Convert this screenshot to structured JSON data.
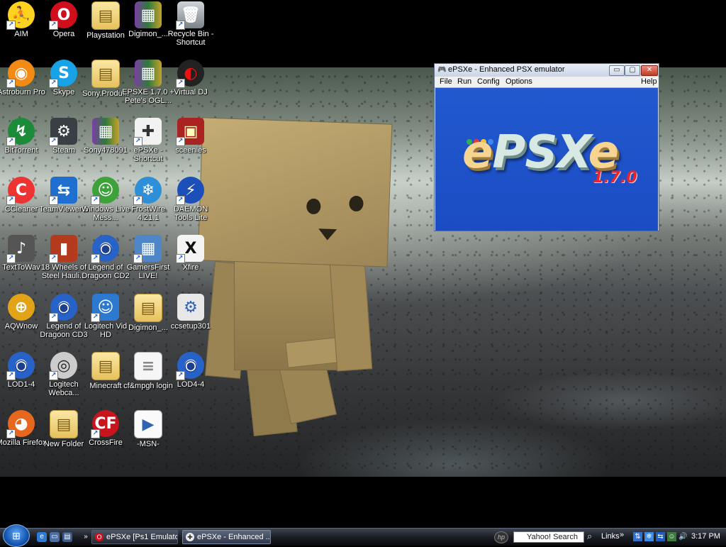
{
  "desktop": {
    "icons": [
      {
        "label": "AIM",
        "glyph": "⛹",
        "icon": "aim-icon",
        "shortcut": true
      },
      {
        "label": "Opera",
        "glyph": "O",
        "icon": "opera-icon",
        "shortcut": true
      },
      {
        "label": "Playstation",
        "glyph": "▤",
        "icon": "folder-icon",
        "shortcut": false
      },
      {
        "label": "Digimon_...",
        "glyph": "▦",
        "icon": "winrar-archive-icon",
        "shortcut": false
      },
      {
        "label": "Recycle Bin - Shortcut",
        "glyph": "🗑",
        "icon": "recycle-bin-icon",
        "shortcut": true
      },
      {
        "label": "Astroburn Pro",
        "glyph": "◉",
        "icon": "astroburn-icon",
        "shortcut": true
      },
      {
        "label": "Skype",
        "glyph": "S",
        "icon": "skype-icon",
        "shortcut": true
      },
      {
        "label": "Sony.Produ...",
        "glyph": "▤",
        "icon": "folder-icon",
        "shortcut": false
      },
      {
        "label": "EPSXE 1.7.0 + Pete's OGL...",
        "glyph": "▦",
        "icon": "winrar-archive-icon",
        "shortcut": false
      },
      {
        "label": "Virtual DJ",
        "glyph": "◐",
        "icon": "virtual-dj-icon",
        "shortcut": true
      },
      {
        "label": "BitTorrent",
        "glyph": "↯",
        "icon": "bittorrent-icon",
        "shortcut": true
      },
      {
        "label": "Steam",
        "glyph": "⚙",
        "icon": "steam-icon",
        "shortcut": true
      },
      {
        "label": "Sony478091",
        "glyph": "▦",
        "icon": "winrar-archive-icon",
        "shortcut": false
      },
      {
        "label": "ePSXe - Shortcut",
        "glyph": "✚",
        "icon": "gamepad-icon",
        "shortcut": true
      },
      {
        "label": "sceenies",
        "glyph": "▣",
        "icon": "screenshots-folder-icon",
        "shortcut": true
      },
      {
        "label": "CCleaner",
        "glyph": "C",
        "icon": "ccleaner-icon",
        "shortcut": true
      },
      {
        "label": "TeamViewer 5",
        "glyph": "⇆",
        "icon": "teamviewer-icon",
        "shortcut": true
      },
      {
        "label": "Windows Live Mess...",
        "glyph": "☺",
        "icon": "messenger-icon",
        "shortcut": true
      },
      {
        "label": "FrostWire 4.21.1",
        "glyph": "❄",
        "icon": "frostwire-icon",
        "shortcut": true
      },
      {
        "label": "DAEMON Tools Lite",
        "glyph": "⚡",
        "icon": "daemon-tools-icon",
        "shortcut": true
      },
      {
        "label": "TextToWav",
        "glyph": "♪",
        "icon": "speaker-icon",
        "shortcut": true
      },
      {
        "label": "18 Wheels of Steel Hauli...",
        "glyph": "▮",
        "icon": "truck-game-icon",
        "shortcut": true
      },
      {
        "label": "Legend of Dragoon CD2",
        "glyph": "◉",
        "icon": "disc-icon",
        "shortcut": true
      },
      {
        "label": "GamersFirst LIVE!",
        "glyph": "▦",
        "icon": "gamersfirst-icon",
        "shortcut": true
      },
      {
        "label": "Xfire",
        "glyph": "X",
        "icon": "xfire-icon",
        "shortcut": true
      },
      {
        "label": "AQWnow",
        "glyph": "⊕",
        "icon": "aqwnow-icon",
        "shortcut": false
      },
      {
        "label": "Legend of Dragoon CD3",
        "glyph": "◉",
        "icon": "disc-icon",
        "shortcut": true
      },
      {
        "label": "Logitech Vid HD",
        "glyph": "☺",
        "icon": "logitech-vid-icon",
        "shortcut": true
      },
      {
        "label": "Digimon_...",
        "glyph": "▤",
        "icon": "folder-icon",
        "shortcut": false
      },
      {
        "label": "ccsetup301",
        "glyph": "⚙",
        "icon": "installer-icon",
        "shortcut": false
      },
      {
        "label": "LOD1-4",
        "glyph": "◉",
        "icon": "disc-icon",
        "shortcut": true
      },
      {
        "label": "Logitech Webca...",
        "glyph": "◎",
        "icon": "webcam-icon",
        "shortcut": true
      },
      {
        "label": "Minecraft",
        "glyph": "▤",
        "icon": "folder-icon",
        "shortcut": false
      },
      {
        "label": "cf&mpgh login",
        "glyph": "≡",
        "icon": "text-document-icon",
        "shortcut": false
      },
      {
        "label": "LOD4-4",
        "glyph": "◉",
        "icon": "disc-icon",
        "shortcut": true
      },
      {
        "label": "Mozilla Firefox",
        "glyph": "◕",
        "icon": "firefox-icon",
        "shortcut": true
      },
      {
        "label": "New Folder",
        "glyph": "▤",
        "icon": "folder-icon",
        "shortcut": false
      },
      {
        "label": "CrossFire",
        "glyph": "CF",
        "icon": "crossfire-icon",
        "shortcut": true
      },
      {
        "label": "-MSN-",
        "glyph": "▶",
        "icon": "mp4-file-icon",
        "shortcut": false
      }
    ]
  },
  "window": {
    "title": "ePSXe - Enhanced PSX emulator",
    "icon": "epsxe-app-icon",
    "controls": {
      "minimize": "▭",
      "maximize": "▢",
      "close": "✕"
    },
    "menu": {
      "file": "File",
      "run": "Run",
      "config": "Config",
      "options": "Options",
      "help": "Help"
    },
    "splash": {
      "logo_e": "e",
      "logo_psx": "PSX",
      "logo_e2": "e",
      "version": "1.7.0"
    }
  },
  "taskbar": {
    "start_glyph": "⊞",
    "quick_launch": [
      "ie-icon",
      "show-desktop-icon",
      "window-switch-icon"
    ],
    "overflow": "»",
    "buttons": [
      {
        "label": "ePSXe [Ps1 Emulato...",
        "icon": "opera-icon",
        "active": false
      },
      {
        "label": "ePSXe - Enhanced ...",
        "icon": "gamepad-icon",
        "active": true
      }
    ],
    "search_text": "Yahoo! Search",
    "links_label": "Links",
    "clock": "3:17 PM"
  },
  "colors": {
    "window_canvas": "#1f52c9",
    "titlebar": "#d7e2f0",
    "taskbar": "#1a1d24"
  }
}
